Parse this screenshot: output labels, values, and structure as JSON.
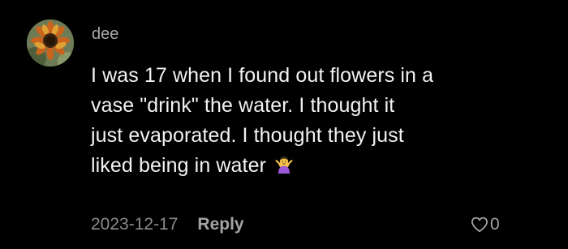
{
  "comment": {
    "username": "dee",
    "lines": [
      "I was 17 when I found out flowers in a",
      "vase \"drink\" the water. I thought it",
      "just evaporated. I thought they just",
      "liked being in water"
    ],
    "emoji_icon": "person-shrugging-emoji",
    "avatar_icon": "sunflower-avatar",
    "date": "2023-12-17",
    "reply_label": "Reply",
    "like_icon": "heart-outline-icon",
    "like_count": "0"
  },
  "colors": {
    "background": "#000000",
    "text": "#f2f2f2",
    "muted": "#a8a8a8"
  }
}
